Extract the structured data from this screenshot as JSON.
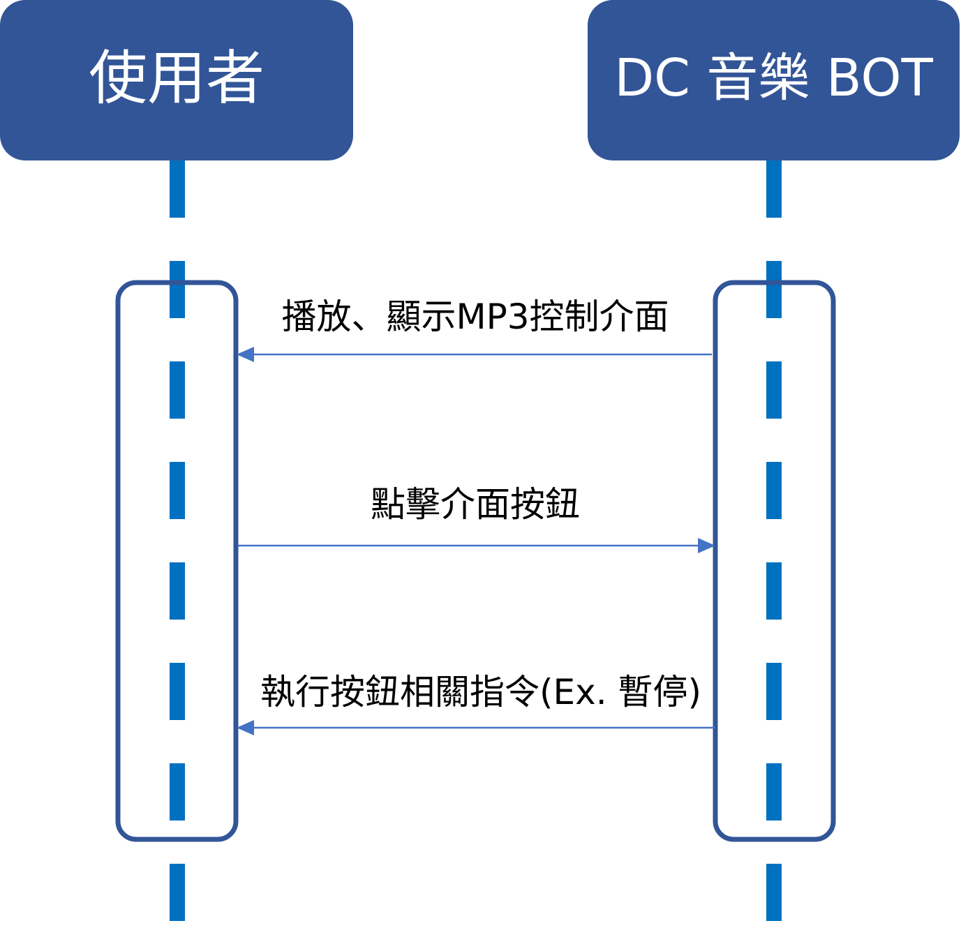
{
  "colors": {
    "actor_fill": "#325597",
    "actor_text": "#ffffff",
    "lifeline": "#0070C0",
    "activation_border": "#325597",
    "arrow": "#4472C4",
    "message_text": "#000000"
  },
  "actors": [
    {
      "id": "user",
      "label": "使用者"
    },
    {
      "id": "bot",
      "label": "DC 音樂 BOT"
    }
  ],
  "messages": [
    {
      "from": "bot",
      "to": "user",
      "label": "播放、顯示MP3控制介面"
    },
    {
      "from": "user",
      "to": "bot",
      "label": "點擊介面按鈕"
    },
    {
      "from": "bot",
      "to": "user",
      "label": "執行按鈕相關指令(Ex. 暫停)"
    }
  ]
}
